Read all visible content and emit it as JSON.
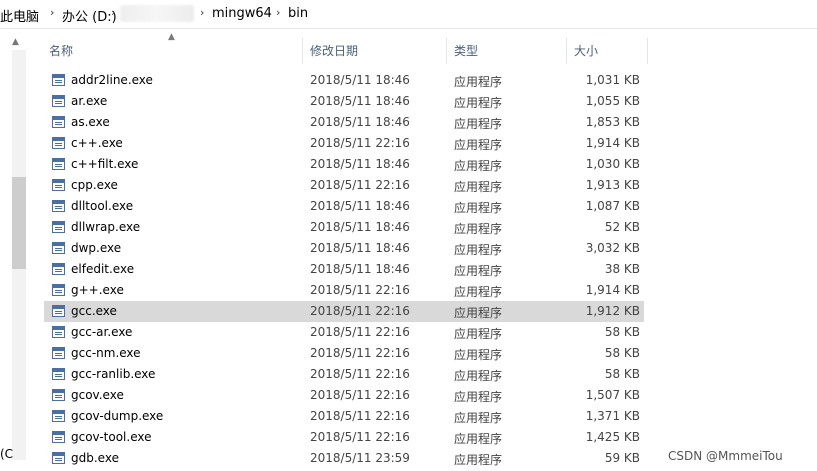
{
  "breadcrumb": {
    "items": [
      "此电脑",
      "办公 (D:)",
      "mingw64",
      "bin"
    ],
    "separator": "›"
  },
  "columns": {
    "name": "名称",
    "date": "修改日期",
    "type": "类型",
    "size": "大小"
  },
  "left_edge_text": "(C",
  "selected_index": 11,
  "files": [
    {
      "name": "addr2line.exe",
      "date": "2018/5/11 18:46",
      "type": "应用程序",
      "size": "1,031 KB"
    },
    {
      "name": "ar.exe",
      "date": "2018/5/11 18:46",
      "type": "应用程序",
      "size": "1,055 KB"
    },
    {
      "name": "as.exe",
      "date": "2018/5/11 18:46",
      "type": "应用程序",
      "size": "1,853 KB"
    },
    {
      "name": "c++.exe",
      "date": "2018/5/11 22:16",
      "type": "应用程序",
      "size": "1,914 KB"
    },
    {
      "name": "c++filt.exe",
      "date": "2018/5/11 18:46",
      "type": "应用程序",
      "size": "1,030 KB"
    },
    {
      "name": "cpp.exe",
      "date": "2018/5/11 22:16",
      "type": "应用程序",
      "size": "1,913 KB"
    },
    {
      "name": "dlltool.exe",
      "date": "2018/5/11 18:46",
      "type": "应用程序",
      "size": "1,087 KB"
    },
    {
      "name": "dllwrap.exe",
      "date": "2018/5/11 18:46",
      "type": "应用程序",
      "size": "52 KB"
    },
    {
      "name": "dwp.exe",
      "date": "2018/5/11 18:46",
      "type": "应用程序",
      "size": "3,032 KB"
    },
    {
      "name": "elfedit.exe",
      "date": "2018/5/11 18:46",
      "type": "应用程序",
      "size": "38 KB"
    },
    {
      "name": "g++.exe",
      "date": "2018/5/11 22:16",
      "type": "应用程序",
      "size": "1,914 KB"
    },
    {
      "name": "gcc.exe",
      "date": "2018/5/11 22:16",
      "type": "应用程序",
      "size": "1,912 KB"
    },
    {
      "name": "gcc-ar.exe",
      "date": "2018/5/11 22:16",
      "type": "应用程序",
      "size": "58 KB"
    },
    {
      "name": "gcc-nm.exe",
      "date": "2018/5/11 22:16",
      "type": "应用程序",
      "size": "58 KB"
    },
    {
      "name": "gcc-ranlib.exe",
      "date": "2018/5/11 22:16",
      "type": "应用程序",
      "size": "58 KB"
    },
    {
      "name": "gcov.exe",
      "date": "2018/5/11 22:16",
      "type": "应用程序",
      "size": "1,507 KB"
    },
    {
      "name": "gcov-dump.exe",
      "date": "2018/5/11 22:16",
      "type": "应用程序",
      "size": "1,371 KB"
    },
    {
      "name": "gcov-tool.exe",
      "date": "2018/5/11 22:16",
      "type": "应用程序",
      "size": "1,425 KB"
    },
    {
      "name": "gdb.exe",
      "date": "2018/5/11 23:59",
      "type": "应用程序",
      "size": "59 KB"
    }
  ],
  "watermark": "CSDN @MmmeiTou",
  "colors": {
    "header_text": "#4c607a",
    "selected_row": "#d9d9d9",
    "icon_blue": "#4a6fa5"
  }
}
